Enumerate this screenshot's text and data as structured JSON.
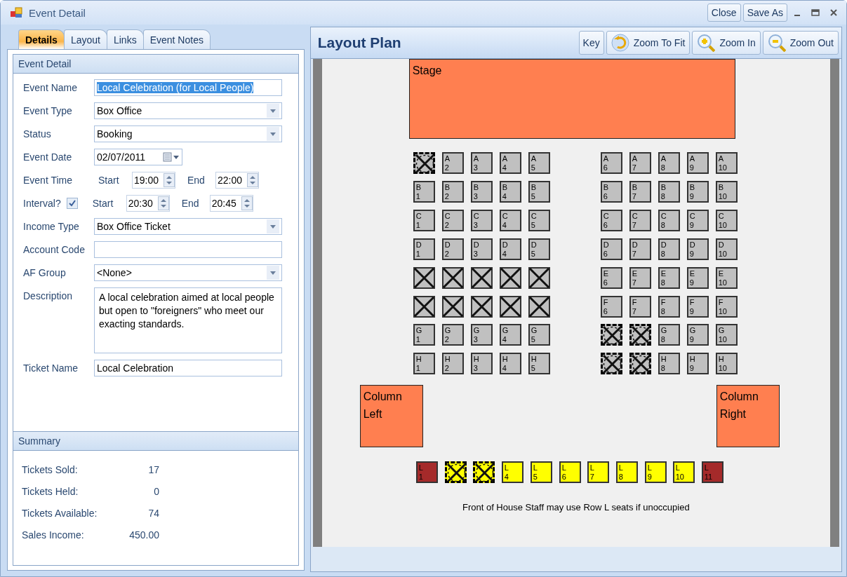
{
  "window": {
    "title": "Event Detail",
    "buttons": [
      "Close",
      "Save As"
    ]
  },
  "tabs": [
    {
      "label": "Details",
      "selected": true
    },
    {
      "label": "Layout",
      "selected": false
    },
    {
      "label": "Links",
      "selected": false
    },
    {
      "label": "Event Notes",
      "selected": false
    }
  ],
  "event_detail": {
    "title": "Event Detail",
    "fields": [
      {
        "kind": "text",
        "label": "Event Name",
        "value": "Local Celebration (for Local People)",
        "highlighted": true
      },
      {
        "kind": "dropdown",
        "label": "Event Type",
        "value": "Box Office"
      },
      {
        "kind": "dropdown",
        "label": "Status",
        "value": "Booking"
      },
      {
        "kind": "date",
        "label": "Event Date",
        "value": "02/07/2011"
      },
      {
        "kind": "time",
        "label": "Event Time",
        "start_label": "Start",
        "start": "19:00",
        "end_label": "End",
        "end": "22:00"
      },
      {
        "kind": "time",
        "label": "Interval?",
        "checked": true,
        "start_label": "Start",
        "start": "20:30",
        "end_label": "End",
        "end": "20:45"
      },
      {
        "kind": "dropdown",
        "label": "Income Type",
        "value": "Box Office Ticket"
      },
      {
        "kind": "text",
        "label": "Account Code"
      },
      {
        "kind": "dropdown",
        "label": "AF Group",
        "value": "<None>"
      },
      {
        "kind": "textarea",
        "label": "Description",
        "value": "A local celebration aimed at local people but open to \"foreigners\" who meet our exacting standards."
      },
      {
        "kind": "text",
        "label": "Ticket Name",
        "value": "Local Celebration"
      }
    ]
  },
  "summary": {
    "title": "Summary",
    "rows": [
      {
        "label": "Tickets Sold:",
        "value": "17"
      },
      {
        "label": "Tickets Held:",
        "value": "0"
      },
      {
        "label": "Tickets Available:",
        "value": "74"
      },
      {
        "label": "Sales Income:",
        "value": "450.00"
      }
    ]
  },
  "layout_plan": {
    "title": "Layout Plan",
    "tools": [
      {
        "kind": "plain",
        "label": "Key"
      },
      {
        "kind": "zoom-fit",
        "label": "Zoom To Fit"
      },
      {
        "kind": "zoom-in",
        "label": "Zoom In"
      },
      {
        "kind": "zoom-out",
        "label": "Zoom Out"
      }
    ],
    "areas": [
      {
        "kind": "stage",
        "label": "Stage"
      },
      {
        "kind": "column-left",
        "label": "Column Left"
      },
      {
        "kind": "column-right",
        "label": "Column Right"
      }
    ],
    "seat_rows": [
      {
        "left": [
          {
            "held": true,
            "sold": false,
            "color": "#c0c0c0"
          },
          {
            "row": "A",
            "number": "2",
            "held": false,
            "sold": false,
            "color": "#c0c0c0"
          },
          {
            "row": "A",
            "number": "3",
            "held": false,
            "sold": false,
            "color": "#c0c0c0"
          },
          {
            "row": "A",
            "number": "4",
            "held": false,
            "sold": false,
            "color": "#c0c0c0"
          },
          {
            "row": "A",
            "number": "5",
            "held": false,
            "sold": false,
            "color": "#c0c0c0"
          }
        ],
        "right": [
          {
            "row": "A",
            "number": "6",
            "held": false,
            "sold": false,
            "color": "#c0c0c0"
          },
          {
            "row": "A",
            "number": "7",
            "held": false,
            "sold": false,
            "color": "#c0c0c0"
          },
          {
            "row": "A",
            "number": "8",
            "held": false,
            "sold": false,
            "color": "#c0c0c0"
          },
          {
            "row": "A",
            "number": "9",
            "held": false,
            "sold": false,
            "color": "#c0c0c0"
          },
          {
            "row": "A",
            "number": "10",
            "held": false,
            "sold": false,
            "color": "#c0c0c0"
          }
        ]
      },
      {
        "left": [
          {
            "row": "B",
            "number": "1",
            "held": false,
            "sold": false,
            "color": "#c0c0c0"
          },
          {
            "row": "B",
            "number": "2",
            "held": false,
            "sold": false,
            "color": "#c0c0c0"
          },
          {
            "row": "B",
            "number": "3",
            "held": false,
            "sold": false,
            "color": "#c0c0c0"
          },
          {
            "row": "B",
            "number": "4",
            "held": false,
            "sold": false,
            "color": "#c0c0c0"
          },
          {
            "row": "B",
            "number": "5",
            "held": false,
            "sold": false,
            "color": "#c0c0c0"
          }
        ],
        "right": [
          {
            "row": "B",
            "number": "6",
            "held": false,
            "sold": false,
            "color": "#c0c0c0"
          },
          {
            "row": "B",
            "number": "7",
            "held": false,
            "sold": false,
            "color": "#c0c0c0"
          },
          {
            "row": "B",
            "number": "8",
            "held": false,
            "sold": false,
            "color": "#c0c0c0"
          },
          {
            "row": "B",
            "number": "9",
            "held": false,
            "sold": false,
            "color": "#c0c0c0"
          },
          {
            "row": "B",
            "number": "10",
            "held": false,
            "sold": false,
            "color": "#c0c0c0"
          }
        ]
      },
      {
        "left": [
          {
            "row": "C",
            "number": "1",
            "held": false,
            "sold": false,
            "color": "#c0c0c0"
          },
          {
            "row": "C",
            "number": "2",
            "held": false,
            "sold": false,
            "color": "#c0c0c0"
          },
          {
            "row": "C",
            "number": "3",
            "held": false,
            "sold": false,
            "color": "#c0c0c0"
          },
          {
            "row": "C",
            "number": "4",
            "held": false,
            "sold": false,
            "color": "#c0c0c0"
          },
          {
            "row": "C",
            "number": "5",
            "held": false,
            "sold": false,
            "color": "#c0c0c0"
          }
        ],
        "right": [
          {
            "row": "C",
            "number": "6",
            "held": false,
            "sold": false,
            "color": "#c0c0c0"
          },
          {
            "row": "C",
            "number": "7",
            "held": false,
            "sold": false,
            "color": "#c0c0c0"
          },
          {
            "row": "C",
            "number": "8",
            "held": false,
            "sold": false,
            "color": "#c0c0c0"
          },
          {
            "row": "C",
            "number": "9",
            "held": false,
            "sold": false,
            "color": "#c0c0c0"
          },
          {
            "row": "C",
            "number": "10",
            "held": false,
            "sold": false,
            "color": "#c0c0c0"
          }
        ]
      },
      {
        "left": [
          {
            "row": "D",
            "number": "1",
            "held": false,
            "sold": false,
            "color": "#c0c0c0"
          },
          {
            "row": "D",
            "number": "2",
            "held": false,
            "sold": false,
            "color": "#c0c0c0"
          },
          {
            "row": "D",
            "number": "3",
            "held": false,
            "sold": false,
            "color": "#c0c0c0"
          },
          {
            "row": "D",
            "number": "4",
            "held": false,
            "sold": false,
            "color": "#c0c0c0"
          },
          {
            "row": "D",
            "number": "5",
            "held": false,
            "sold": false,
            "color": "#c0c0c0"
          }
        ],
        "right": [
          {
            "row": "D",
            "number": "6",
            "held": false,
            "sold": false,
            "color": "#c0c0c0"
          },
          {
            "row": "D",
            "number": "7",
            "held": false,
            "sold": false,
            "color": "#c0c0c0"
          },
          {
            "row": "D",
            "number": "8",
            "held": false,
            "sold": false,
            "color": "#c0c0c0"
          },
          {
            "row": "D",
            "number": "9",
            "held": false,
            "sold": false,
            "color": "#c0c0c0"
          },
          {
            "row": "D",
            "number": "10",
            "held": false,
            "sold": false,
            "color": "#c0c0c0"
          }
        ]
      },
      {
        "left": [
          {
            "held": false,
            "sold": true,
            "color": "#c0c0c0"
          },
          {
            "held": false,
            "sold": true,
            "color": "#c0c0c0"
          },
          {
            "held": false,
            "sold": true,
            "color": "#c0c0c0"
          },
          {
            "held": false,
            "sold": true,
            "color": "#c0c0c0"
          },
          {
            "held": false,
            "sold": true,
            "color": "#c0c0c0"
          }
        ],
        "right": [
          {
            "row": "E",
            "number": "6",
            "held": false,
            "sold": false,
            "color": "#c0c0c0"
          },
          {
            "row": "E",
            "number": "7",
            "held": false,
            "sold": false,
            "color": "#c0c0c0"
          },
          {
            "row": "E",
            "number": "8",
            "held": false,
            "sold": false,
            "color": "#c0c0c0"
          },
          {
            "row": "E",
            "number": "9",
            "held": false,
            "sold": false,
            "color": "#c0c0c0"
          },
          {
            "row": "E",
            "number": "10",
            "held": false,
            "sold": false,
            "color": "#c0c0c0"
          }
        ]
      },
      {
        "left": [
          {
            "held": false,
            "sold": true,
            "color": "#c0c0c0"
          },
          {
            "held": false,
            "sold": true,
            "color": "#c0c0c0"
          },
          {
            "held": false,
            "sold": true,
            "color": "#c0c0c0"
          },
          {
            "held": false,
            "sold": true,
            "color": "#c0c0c0"
          },
          {
            "held": false,
            "sold": true,
            "color": "#c0c0c0"
          }
        ],
        "right": [
          {
            "row": "F",
            "number": "6",
            "held": false,
            "sold": false,
            "color": "#c0c0c0"
          },
          {
            "row": "F",
            "number": "7",
            "held": false,
            "sold": false,
            "color": "#c0c0c0"
          },
          {
            "row": "F",
            "number": "8",
            "held": false,
            "sold": false,
            "color": "#c0c0c0"
          },
          {
            "row": "F",
            "number": "9",
            "held": false,
            "sold": false,
            "color": "#c0c0c0"
          },
          {
            "row": "F",
            "number": "10",
            "held": false,
            "sold": false,
            "color": "#c0c0c0"
          }
        ]
      },
      {
        "left": [
          {
            "row": "G",
            "number": "1",
            "held": false,
            "sold": false,
            "color": "#c0c0c0"
          },
          {
            "row": "G",
            "number": "2",
            "held": false,
            "sold": false,
            "color": "#c0c0c0"
          },
          {
            "row": "G",
            "number": "3",
            "held": false,
            "sold": false,
            "color": "#c0c0c0"
          },
          {
            "row": "G",
            "number": "4",
            "held": false,
            "sold": false,
            "color": "#c0c0c0"
          },
          {
            "row": "G",
            "number": "5",
            "held": false,
            "sold": false,
            "color": "#c0c0c0"
          }
        ],
        "right": [
          {
            "held": true,
            "sold": false,
            "color": "#c0c0c0"
          },
          {
            "held": true,
            "sold": false,
            "color": "#c0c0c0"
          },
          {
            "row": "G",
            "number": "8",
            "held": false,
            "sold": false,
            "color": "#c0c0c0"
          },
          {
            "row": "G",
            "number": "9",
            "held": false,
            "sold": false,
            "color": "#c0c0c0"
          },
          {
            "row": "G",
            "number": "10",
            "held": false,
            "sold": false,
            "color": "#c0c0c0"
          }
        ]
      },
      {
        "left": [
          {
            "row": "H",
            "number": "1",
            "held": false,
            "sold": false,
            "color": "#c0c0c0"
          },
          {
            "row": "H",
            "number": "2",
            "held": false,
            "sold": false,
            "color": "#c0c0c0"
          },
          {
            "row": "H",
            "number": "3",
            "held": false,
            "sold": false,
            "color": "#c0c0c0"
          },
          {
            "row": "H",
            "number": "4",
            "held": false,
            "sold": false,
            "color": "#c0c0c0"
          },
          {
            "row": "H",
            "number": "5",
            "held": false,
            "sold": false,
            "color": "#c0c0c0"
          }
        ],
        "right": [
          {
            "held": true,
            "sold": false,
            "color": "#c0c0c0"
          },
          {
            "held": true,
            "sold": false,
            "color": "#c0c0c0"
          },
          {
            "row": "H",
            "number": "8",
            "held": false,
            "sold": false,
            "color": "#c0c0c0"
          },
          {
            "row": "H",
            "number": "9",
            "held": false,
            "sold": false,
            "color": "#c0c0c0"
          },
          {
            "row": "H",
            "number": "10",
            "held": false,
            "sold": false,
            "color": "#c0c0c0"
          }
        ]
      }
    ],
    "front_row": [
      {
        "row": "L",
        "number": "1",
        "held": false,
        "sold": false,
        "color": "#a52a2a"
      },
      {
        "held": true,
        "sold": false,
        "color": "#ffff00"
      },
      {
        "held": true,
        "sold": false,
        "color": "#ffff00"
      },
      {
        "row": "L",
        "number": "4",
        "held": false,
        "sold": false,
        "color": "#ffff00"
      },
      {
        "row": "L",
        "number": "5",
        "held": false,
        "sold": false,
        "color": "#ffff00"
      },
      {
        "row": "L",
        "number": "6",
        "held": false,
        "sold": false,
        "color": "#ffff00"
      },
      {
        "row": "L",
        "number": "7",
        "held": false,
        "sold": false,
        "color": "#ffff00"
      },
      {
        "row": "L",
        "number": "8",
        "held": false,
        "sold": false,
        "color": "#ffff00"
      },
      {
        "row": "L",
        "number": "9",
        "held": false,
        "sold": false,
        "color": "#ffff00"
      },
      {
        "row": "L",
        "number": "10",
        "held": false,
        "sold": false,
        "color": "#ffff00"
      },
      {
        "row": "L",
        "number": "11",
        "held": false,
        "sold": false,
        "color": "#a52a2a"
      }
    ],
    "note": "Front of House Staff may use Row L seats if unoccupied"
  }
}
